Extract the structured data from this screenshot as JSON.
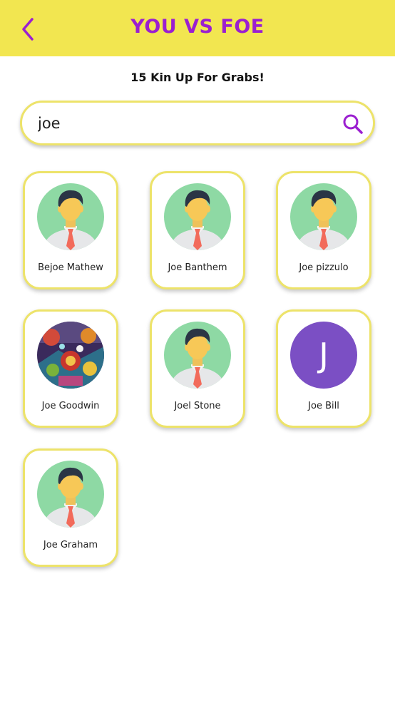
{
  "header": {
    "title": "YOU VS FOE",
    "accent_color": "#9b1fd0",
    "background_color": "#f2e650"
  },
  "subtitle": "15 Kin Up For Grabs!",
  "search": {
    "value": "joe",
    "icon": "search-icon"
  },
  "results": [
    {
      "name": "Bejoe Mathew",
      "avatar": "default-person-avatar"
    },
    {
      "name": "Joe Banthem",
      "avatar": "default-person-avatar"
    },
    {
      "name": "Joe pizzulo",
      "avatar": "default-person-avatar"
    },
    {
      "name": "Joe Goodwin",
      "avatar": "photo-avatar"
    },
    {
      "name": "Joel Stone",
      "avatar": "default-person-avatar"
    },
    {
      "name": "Joe Bill",
      "avatar": "letter-avatar",
      "initial": "J"
    },
    {
      "name": "Joe Graham",
      "avatar": "default-person-avatar"
    }
  ]
}
